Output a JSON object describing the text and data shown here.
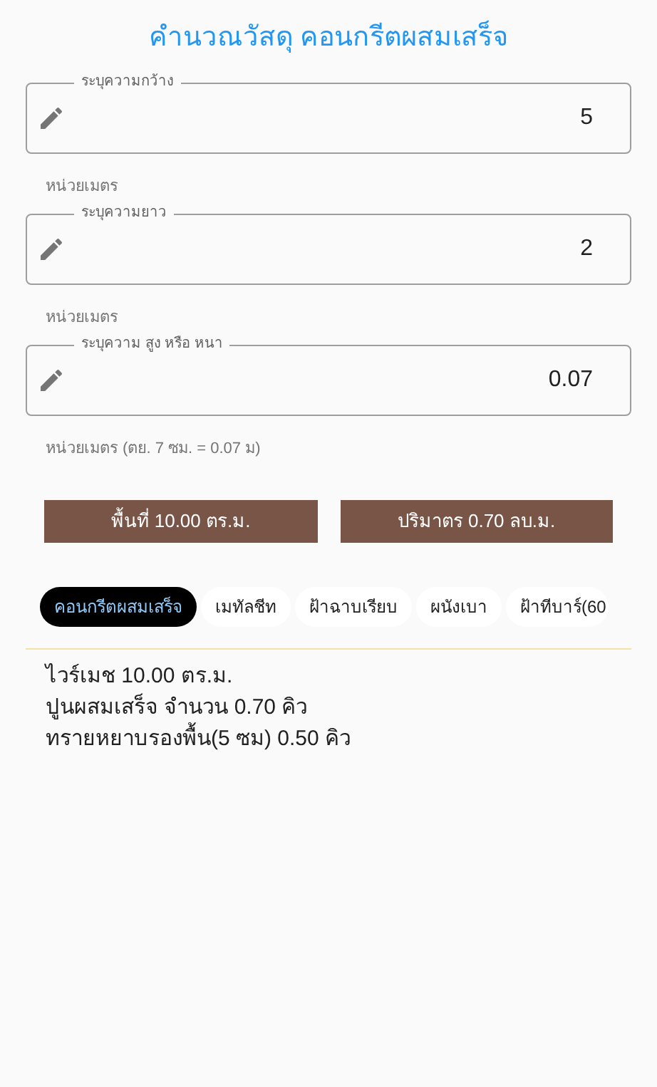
{
  "title": "คำนวณวัสดุ คอนกรีตผสมเสร็จ",
  "fields": [
    {
      "label": "ระบุความกว้าง",
      "value": "5",
      "helper": "หน่วยเมตร"
    },
    {
      "label": "ระบุความยาว",
      "value": "2",
      "helper": "หน่วยเมตร"
    },
    {
      "label": "ระบุความ สูง หรือ หนา",
      "value": "0.07",
      "helper": "หน่วยเมตร (ตย. 7 ซม. = 0.07 ม)"
    }
  ],
  "results": [
    "พื้นที่ 10.00 ตร.ม.",
    "ปริมาตร  0.70 ลบ.ม."
  ],
  "chips": [
    {
      "label": "คอนกรีตผสมเสร็จ",
      "selected": true
    },
    {
      "label": "เมทัลชีท",
      "selected": false
    },
    {
      "label": "ฝ้าฉาบเรียบ",
      "selected": false
    },
    {
      "label": "ผนังเบา",
      "selected": false
    },
    {
      "label": "ฝ้าทีบาร์(60",
      "selected": false
    }
  ],
  "details": [
    "ไวร์เมช 10.00 ตร.ม.",
    "ปูนผสมเสร็จ จำนวน  0.70  คิว",
    "ทรายหยาบรองพื้น(5 ซม) 0.50 คิว"
  ]
}
